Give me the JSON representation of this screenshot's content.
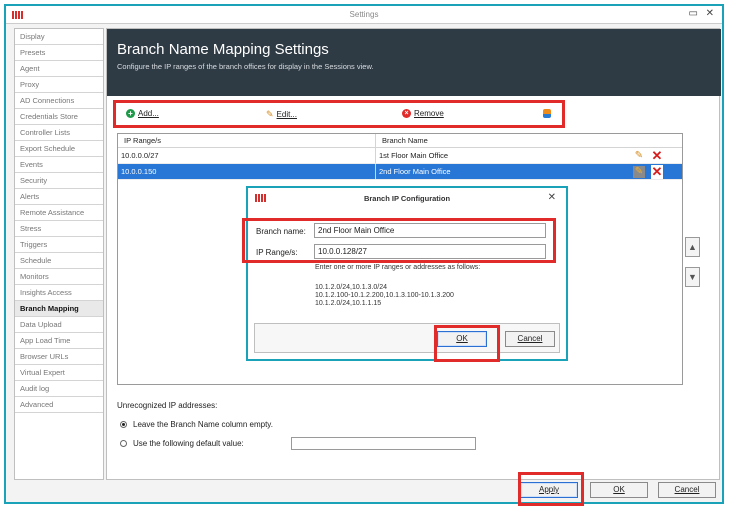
{
  "window": {
    "title": "Settings",
    "minimize_glyph": "▭",
    "close_glyph": "✕"
  },
  "sidebar": {
    "items": [
      {
        "label": "Display"
      },
      {
        "label": "Presets"
      },
      {
        "label": "Agent"
      },
      {
        "label": "Proxy"
      },
      {
        "label": "AD Connections"
      },
      {
        "label": "Credentials Store"
      },
      {
        "label": "Controller Lists"
      },
      {
        "label": "Export Schedule"
      },
      {
        "label": "Events"
      },
      {
        "label": "Security"
      },
      {
        "label": "Alerts"
      },
      {
        "label": "Remote Assistance"
      },
      {
        "label": "Stress"
      },
      {
        "label": "Triggers"
      },
      {
        "label": "Schedule"
      },
      {
        "label": "Monitors"
      },
      {
        "label": "Insights Access"
      },
      {
        "label": "Branch Mapping"
      },
      {
        "label": "Data Upload"
      },
      {
        "label": "App Load Time"
      },
      {
        "label": "Browser URLs"
      },
      {
        "label": "Virtual Expert"
      },
      {
        "label": "Audit log"
      },
      {
        "label": "Advanced"
      }
    ],
    "active_index": 17
  },
  "header": {
    "title": "Branch Name Mapping Settings",
    "subtitle": "Configure the IP ranges of the branch offices for display in the Sessions view."
  },
  "toolbar": {
    "add_label": "Add...",
    "edit_label": "Edit...",
    "remove_label": "Remove"
  },
  "table": {
    "columns": [
      "IP Range/s",
      "Branch Name"
    ],
    "rows": [
      {
        "ip": "10.0.0.0/27",
        "branch": "1st Floor Main Office"
      },
      {
        "ip": "10.0.0.150",
        "branch": "2nd Floor Main Office"
      }
    ],
    "selected_row": 1
  },
  "dialog": {
    "title": "Branch IP Configuration",
    "close_glyph": "✕",
    "branch_name_label": "Branch name:",
    "branch_name_value": "2nd Floor Main Office",
    "ip_ranges_label": "IP Range/s:",
    "ip_ranges_value": "10.0.0.128/27",
    "help_text": "Enter one or more IP ranges or addresses as follows:",
    "examples": [
      "10.1.2.0/24,10.1.3.0/24",
      "10.1.2.100-10.1.2.200,10.1.3.100-10.1.3.200",
      "10.1.2.0/24,10.1.1.15"
    ],
    "ok_label": "OK",
    "cancel_label": "Cancel"
  },
  "unrecognized": {
    "label": "Unrecognized IP addresses:",
    "option_empty": "Leave the Branch Name column empty.",
    "option_default": "Use the following default value:",
    "selected": "empty",
    "default_value": ""
  },
  "footer": {
    "apply_label": "Apply",
    "ok_label": "OK",
    "cancel_label": "Cancel"
  },
  "colors": {
    "accent": "#1aa3b8",
    "highlight": "#e12b2b",
    "header_bg": "#2e3a44",
    "selection": "#2877d6"
  }
}
